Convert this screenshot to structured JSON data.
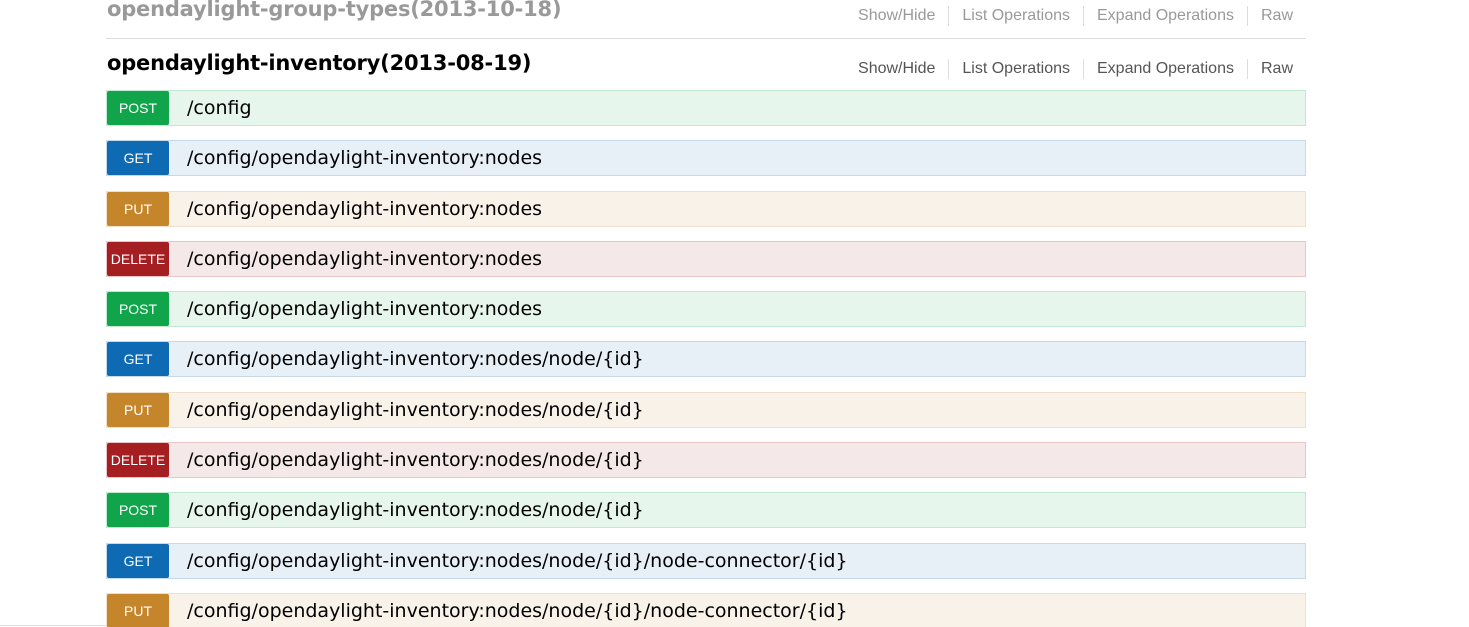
{
  "resources": [
    {
      "title": "opendaylight-group-types(2013-10-18)",
      "options": [
        "Show/Hide",
        "List Operations",
        "Expand Operations",
        "Raw"
      ]
    },
    {
      "title": "opendaylight-inventory(2013-08-19)",
      "options": [
        "Show/Hide",
        "List Operations",
        "Expand Operations",
        "Raw"
      ]
    }
  ],
  "operations": [
    {
      "method": "POST",
      "path": "/config"
    },
    {
      "method": "GET",
      "path": "/config/opendaylight-inventory:nodes"
    },
    {
      "method": "PUT",
      "path": "/config/opendaylight-inventory:nodes"
    },
    {
      "method": "DELETE",
      "path": "/config/opendaylight-inventory:nodes"
    },
    {
      "method": "POST",
      "path": "/config/opendaylight-inventory:nodes"
    },
    {
      "method": "GET",
      "path": "/config/opendaylight-inventory:nodes/node/{id}"
    },
    {
      "method": "PUT",
      "path": "/config/opendaylight-inventory:nodes/node/{id}"
    },
    {
      "method": "DELETE",
      "path": "/config/opendaylight-inventory:nodes/node/{id}"
    },
    {
      "method": "POST",
      "path": "/config/opendaylight-inventory:nodes/node/{id}"
    },
    {
      "method": "GET",
      "path": "/config/opendaylight-inventory:nodes/node/{id}/node-connector/{id}"
    },
    {
      "method": "PUT",
      "path": "/config/opendaylight-inventory:nodes/node/{id}/node-connector/{id}"
    }
  ],
  "colors": {
    "post": "#10a54a",
    "get": "#0f6ab4",
    "put": "#c5862b",
    "delete": "#a41e22"
  }
}
